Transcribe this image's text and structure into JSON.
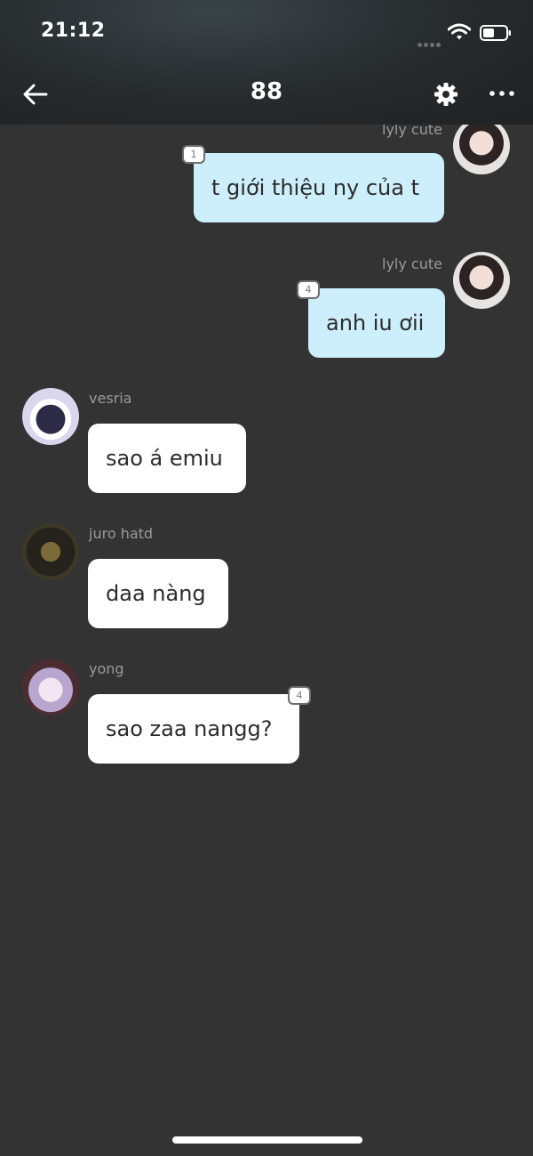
{
  "status": {
    "time": "21:12"
  },
  "nav": {
    "title": "88"
  },
  "messages": [
    {
      "sender": "lyly cute",
      "text": "t giới thiệu ny của t",
      "badge": "1",
      "own": true
    },
    {
      "sender": "lyly cute",
      "text": "anh iu ơii",
      "badge": "4",
      "own": true
    },
    {
      "sender": "vesria",
      "text": "sao á emiu",
      "own": false
    },
    {
      "sender": "juro hatd",
      "text": "daa nàng",
      "own": false
    },
    {
      "sender": "yong",
      "text": "sao zaa nangg?",
      "badge": "4",
      "own": false
    }
  ],
  "colors": {
    "background": "#333333",
    "own_bubble": "#cdeefb",
    "other_bubble": "#ffffff"
  },
  "icons": [
    "back-arrow-icon",
    "gear-icon",
    "more-icon",
    "wifi-icon",
    "battery-icon",
    "signal-icon"
  ]
}
